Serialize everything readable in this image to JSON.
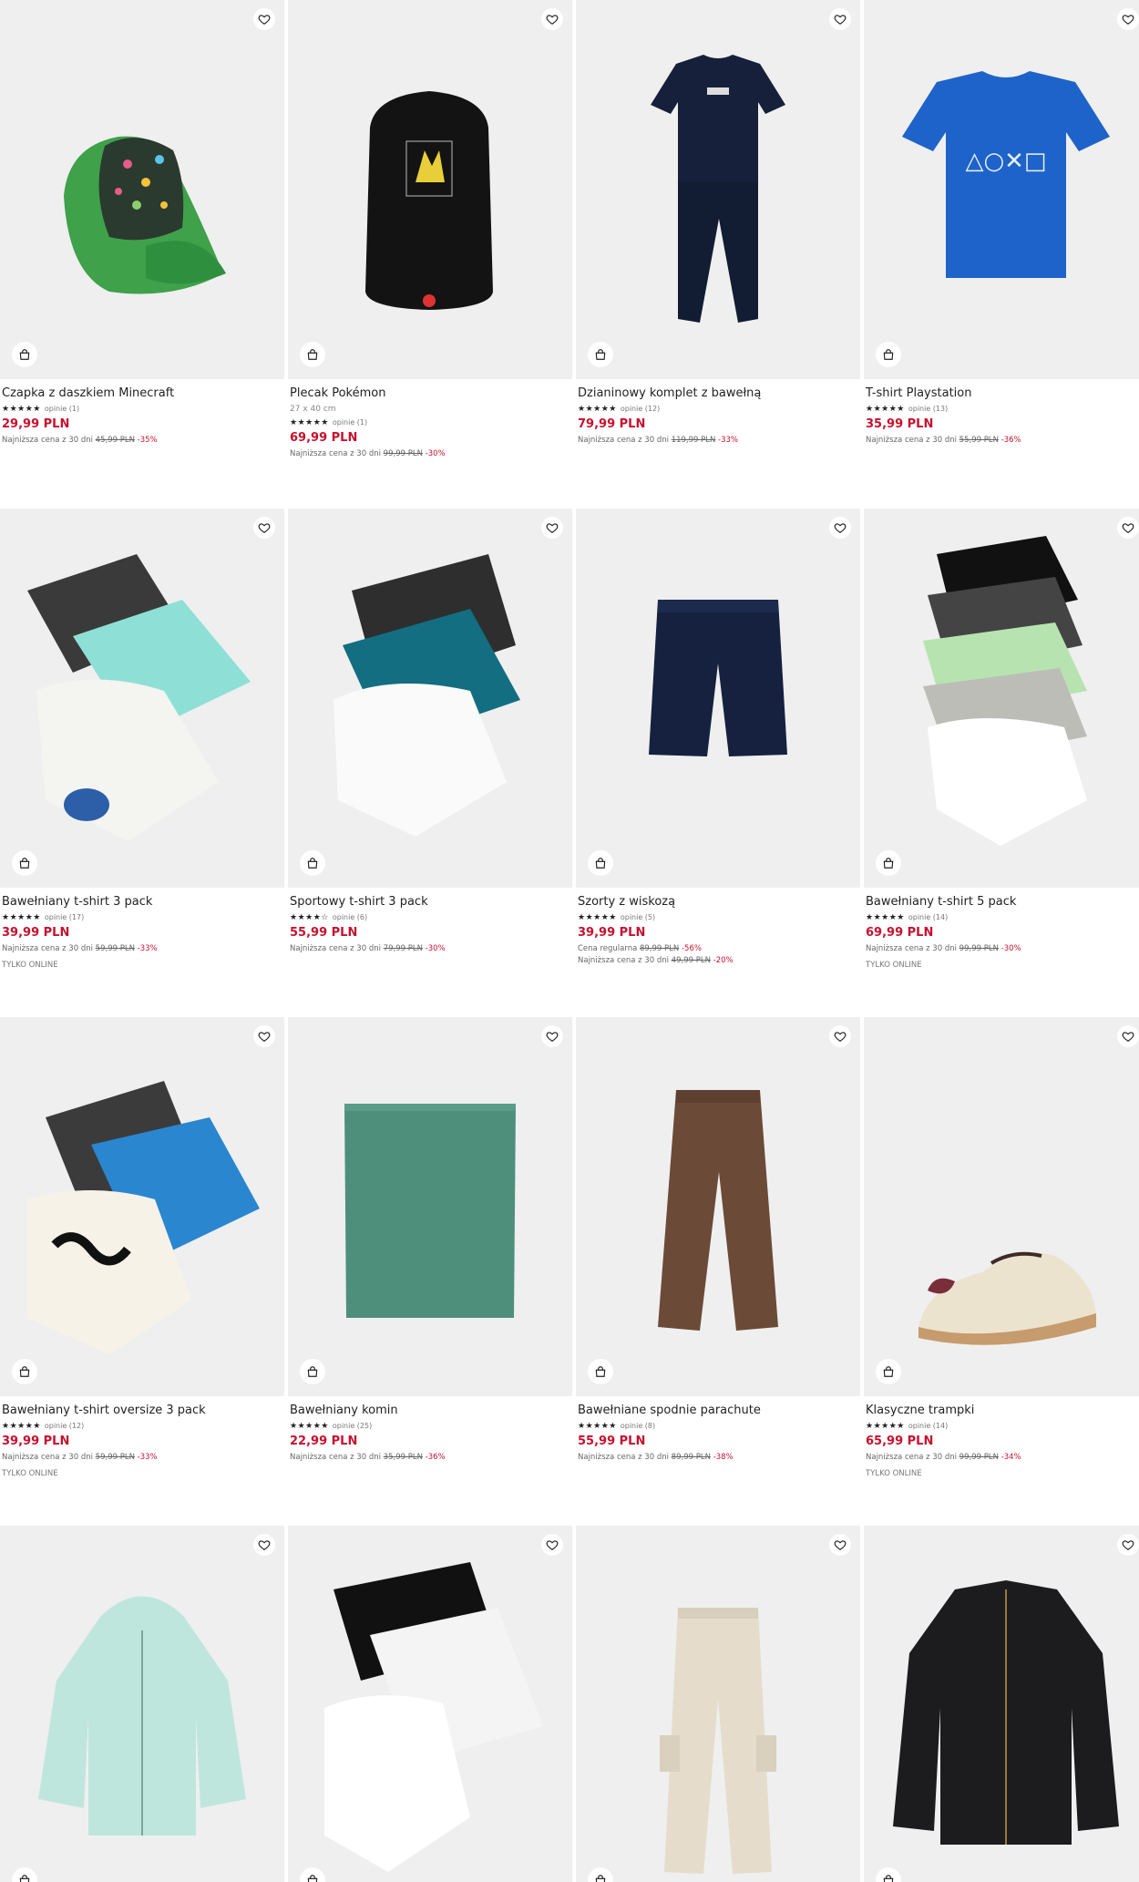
{
  "products": [
    {
      "name": "Czapka z daszkiem Minecraft",
      "size": "",
      "stars": "★★★★★",
      "reviews": "opinie (1)",
      "price": "29,99 PLN",
      "regular_label": "",
      "regular_old": "",
      "regular_disc": "",
      "lowest_label": "Najniższa cena z 30 dni",
      "lowest_old": "45,99 PLN",
      "lowest_disc": "-35%",
      "tag": ""
    },
    {
      "name": "Plecak Pokémon",
      "size": "27 x 40 cm",
      "stars": "★★★★★",
      "reviews": "opinie (1)",
      "price": "69,99 PLN",
      "regular_label": "",
      "regular_old": "",
      "regular_disc": "",
      "lowest_label": "Najniższa cena z 30 dni",
      "lowest_old": "99,99 PLN",
      "lowest_disc": "-30%",
      "tag": ""
    },
    {
      "name": "Dzianinowy komplet z bawełną",
      "size": "",
      "stars": "★★★★★",
      "reviews": "opinie (12)",
      "price": "79,99 PLN",
      "regular_label": "",
      "regular_old": "",
      "regular_disc": "",
      "lowest_label": "Najniższa cena z 30 dni",
      "lowest_old": "119,99 PLN",
      "lowest_disc": "-33%",
      "tag": ""
    },
    {
      "name": "T-shirt Playstation",
      "size": "",
      "stars": "★★★★★",
      "reviews": "opinie (13)",
      "price": "35,99 PLN",
      "regular_label": "",
      "regular_old": "",
      "regular_disc": "",
      "lowest_label": "Najniższa cena z 30 dni",
      "lowest_old": "55,99 PLN",
      "lowest_disc": "-36%",
      "tag": ""
    },
    {
      "name": "Bawełniany t-shirt 3 pack",
      "size": "",
      "stars": "★★★★★",
      "reviews": "opinie (17)",
      "price": "39,99 PLN",
      "regular_label": "",
      "regular_old": "",
      "regular_disc": "",
      "lowest_label": "Najniższa cena z 30 dni",
      "lowest_old": "59,99 PLN",
      "lowest_disc": "-33%",
      "tag": "TYLKO ONLINE"
    },
    {
      "name": "Sportowy t-shirt 3 pack",
      "size": "",
      "stars": "★★★★☆",
      "reviews": "opinie (6)",
      "price": "55,99 PLN",
      "regular_label": "",
      "regular_old": "",
      "regular_disc": "",
      "lowest_label": "Najniższa cena z 30 dni",
      "lowest_old": "79,99 PLN",
      "lowest_disc": "-30%",
      "tag": ""
    },
    {
      "name": "Szorty z wiskozą",
      "size": "",
      "stars": "★★★★★",
      "reviews": "opinie (5)",
      "price": "39,99 PLN",
      "regular_label": "Cena regularna",
      "regular_old": "89,99 PLN",
      "regular_disc": "-56%",
      "lowest_label": "Najniższa cena z 30 dni",
      "lowest_old": "49,99 PLN",
      "lowest_disc": "-20%",
      "tag": ""
    },
    {
      "name": "Bawełniany t-shirt 5 pack",
      "size": "",
      "stars": "★★★★★",
      "reviews": "opinie (14)",
      "price": "69,99 PLN",
      "regular_label": "",
      "regular_old": "",
      "regular_disc": "",
      "lowest_label": "Najniższa cena z 30 dni",
      "lowest_old": "99,99 PLN",
      "lowest_disc": "-30%",
      "tag": "TYLKO ONLINE"
    },
    {
      "name": "Bawełniany t-shirt oversize 3 pack",
      "size": "",
      "stars": "★★★★★",
      "reviews": "opinie (12)",
      "price": "39,99 PLN",
      "regular_label": "",
      "regular_old": "",
      "regular_disc": "",
      "lowest_label": "Najniższa cena z 30 dni",
      "lowest_old": "59,99 PLN",
      "lowest_disc": "-33%",
      "tag": "TYLKO ONLINE"
    },
    {
      "name": "Bawełniany komin",
      "size": "",
      "stars": "★★★★★",
      "reviews": "opinie (25)",
      "price": "22,99 PLN",
      "regular_label": "",
      "regular_old": "",
      "regular_disc": "",
      "lowest_label": "Najniższa cena z 30 dni",
      "lowest_old": "35,99 PLN",
      "lowest_disc": "-36%",
      "tag": ""
    },
    {
      "name": "Bawełniane spodnie parachute",
      "size": "",
      "stars": "★★★★★",
      "reviews": "opinie (8)",
      "price": "55,99 PLN",
      "regular_label": "",
      "regular_old": "",
      "regular_disc": "",
      "lowest_label": "Najniższa cena z 30 dni",
      "lowest_old": "89,99 PLN",
      "lowest_disc": "-38%",
      "tag": ""
    },
    {
      "name": "Klasyczne trampki",
      "size": "",
      "stars": "★★★★★",
      "reviews": "opinie (14)",
      "price": "65,99 PLN",
      "regular_label": "",
      "regular_old": "",
      "regular_disc": "",
      "lowest_label": "Najniższa cena z 30 dni",
      "lowest_old": "99,99 PLN",
      "lowest_disc": "-34%",
      "tag": "TYLKO ONLINE"
    },
    {
      "name": "",
      "size": "",
      "stars": "",
      "reviews": "",
      "price": "",
      "regular_label": "",
      "regular_old": "",
      "regular_disc": "",
      "lowest_label": "",
      "lowest_old": "",
      "lowest_disc": "",
      "tag": ""
    },
    {
      "name": "",
      "size": "",
      "stars": "",
      "reviews": "",
      "price": "",
      "regular_label": "",
      "regular_old": "",
      "regular_disc": "",
      "lowest_label": "",
      "lowest_old": "",
      "lowest_disc": "",
      "tag": ""
    },
    {
      "name": "",
      "size": "",
      "stars": "",
      "reviews": "",
      "price": "",
      "regular_label": "",
      "regular_old": "",
      "regular_disc": "",
      "lowest_label": "",
      "lowest_old": "",
      "lowest_disc": "",
      "tag": ""
    },
    {
      "name": "",
      "size": "",
      "stars": "",
      "reviews": "",
      "price": "",
      "regular_label": "",
      "regular_old": "",
      "regular_disc": "",
      "lowest_label": "",
      "lowest_old": "",
      "lowest_disc": "",
      "tag": ""
    }
  ],
  "icons": {
    "favorite": "heart-icon",
    "add_to_bag": "shopping-bag-icon"
  },
  "colors": {
    "price": "#c8102e",
    "discount": "#c8102e",
    "photo_bg": "#efefef",
    "text": "#222222"
  }
}
